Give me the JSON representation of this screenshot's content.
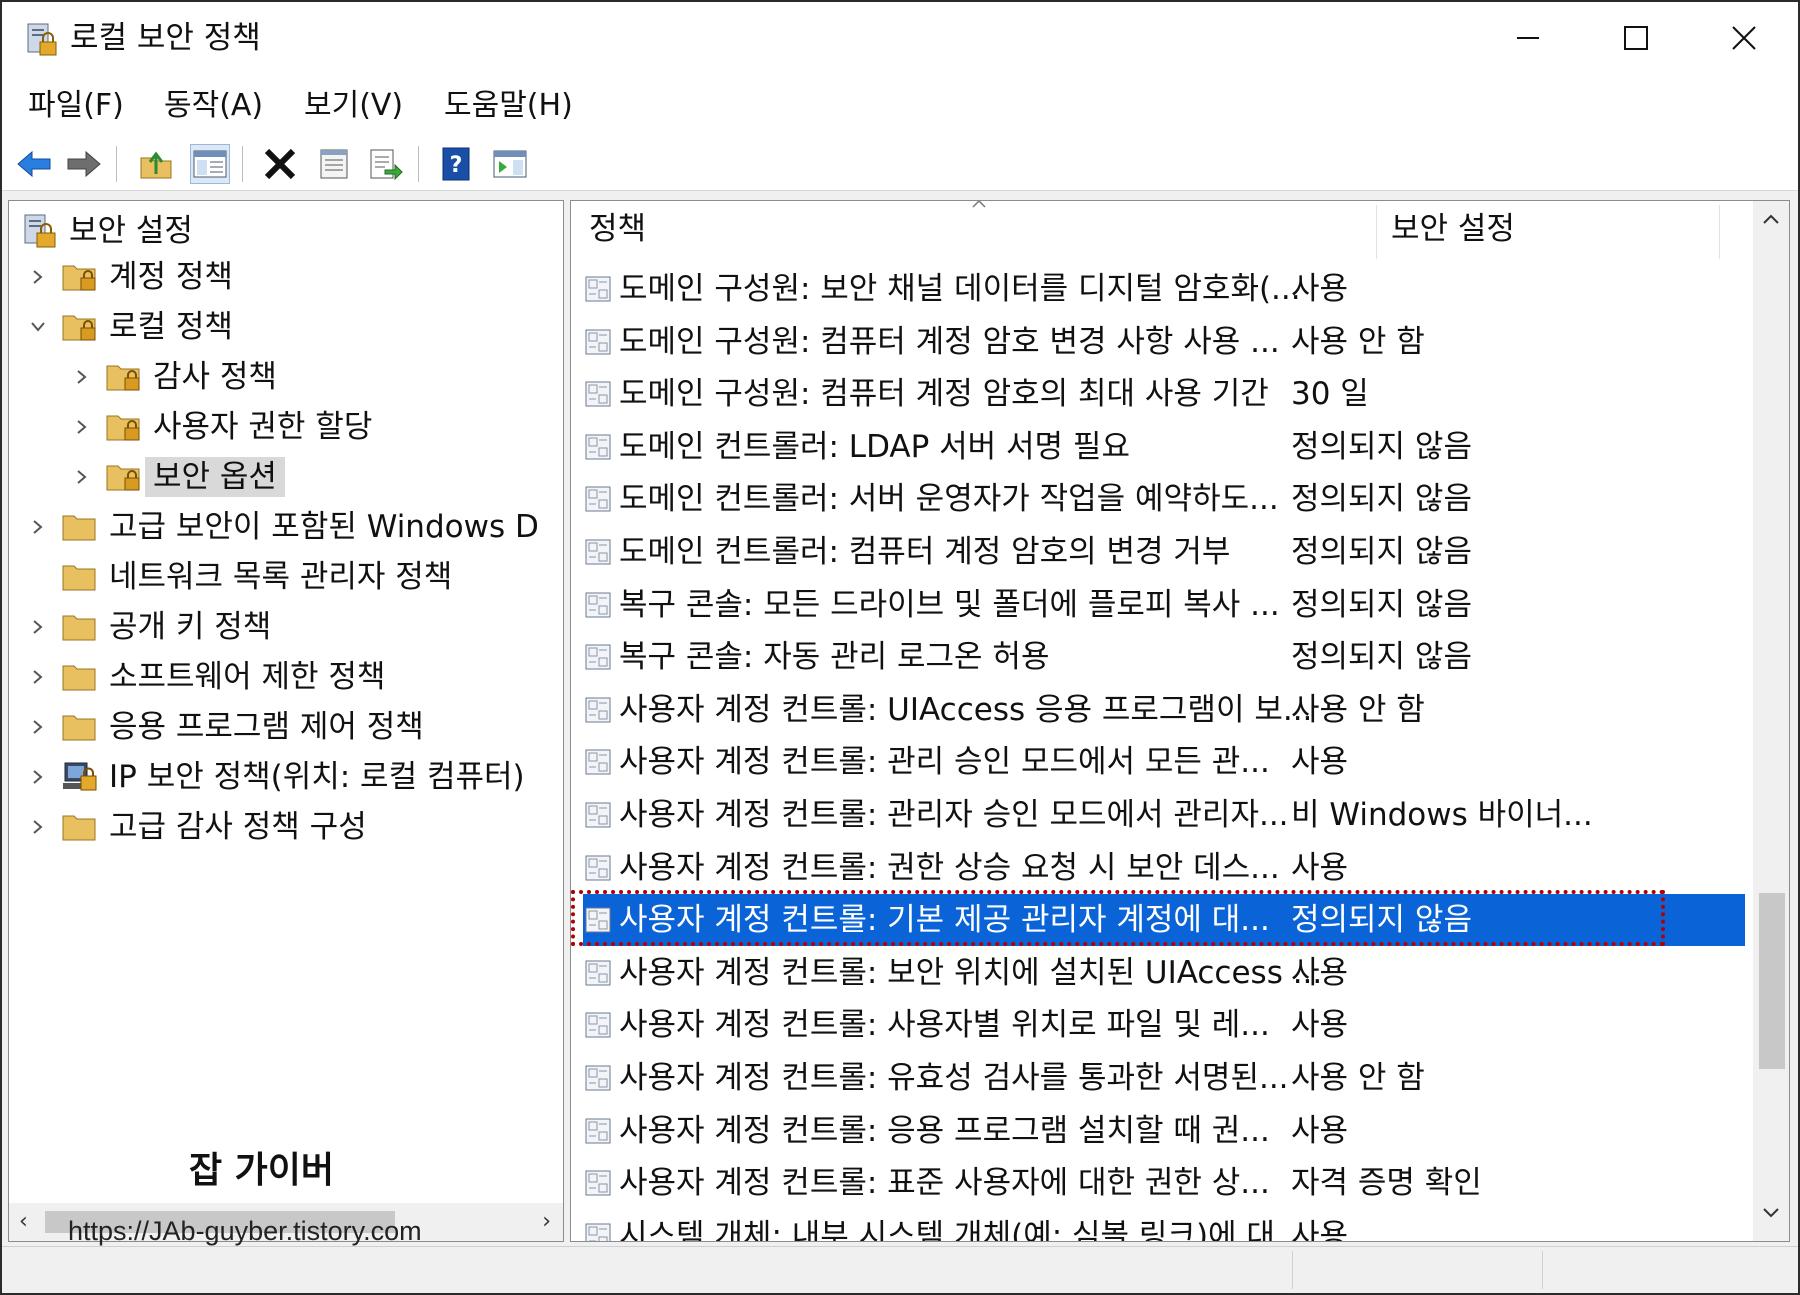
{
  "window": {
    "title": "로컬 보안 정책"
  },
  "menu": {
    "items": [
      "파일(F)",
      "동작(A)",
      "보기(V)",
      "도움말(H)"
    ]
  },
  "toolbar": {
    "buttons": [
      "back-icon",
      "forward-icon",
      "up-folder-icon",
      "show-hide-tree-icon",
      "delete-icon",
      "properties-icon",
      "export-list-icon",
      "help-icon",
      "action-pane-icon"
    ]
  },
  "tree": {
    "root": "보안 설정",
    "account_policy": "계정 정책",
    "local_policy": "로컬 정책",
    "audit_policy": "감사 정책",
    "user_rights": "사용자 권한 할당",
    "security_options": "보안 옵션",
    "windows_defender": "고급 보안이 포함된 Windows D",
    "network_list": "네트워크 목록 관리자 정책",
    "public_key": "공개 키 정책",
    "software_restriction": "소프트웨어 제한 정책",
    "app_control": "응용 프로그램 제어 정책",
    "ipsec": "IP 보안 정책(위치: 로컬 컴퓨터)",
    "advanced_audit": "고급 감사 정책 구성"
  },
  "watermark": {
    "name": "잡 가이버",
    "url": "https://JAb-guyber.tistory.com"
  },
  "list": {
    "columns": {
      "policy": "정책",
      "setting": "보안 설정"
    },
    "rows": [
      {
        "policy": "도메인 구성원: 보안 채널 데이터를 디지털 암호화(...",
        "setting": "사용"
      },
      {
        "policy": "도메인 구성원: 컴퓨터 계정 암호 변경 사항 사용 ...",
        "setting": "사용 안 함"
      },
      {
        "policy": "도메인 구성원: 컴퓨터 계정 암호의 최대 사용 기간",
        "setting": "30 일"
      },
      {
        "policy": "도메인 컨트롤러: LDAP 서버 서명 필요",
        "setting": "정의되지 않음"
      },
      {
        "policy": "도메인 컨트롤러: 서버 운영자가 작업을 예약하도...",
        "setting": "정의되지 않음"
      },
      {
        "policy": "도메인 컨트롤러: 컴퓨터 계정 암호의 변경 거부",
        "setting": "정의되지 않음"
      },
      {
        "policy": "복구 콘솔: 모든 드라이브 및 폴더에 플로피 복사 ...",
        "setting": "정의되지 않음"
      },
      {
        "policy": "복구 콘솔: 자동 관리 로그온 허용",
        "setting": "정의되지 않음"
      },
      {
        "policy": "사용자 계정 컨트롤: UIAccess 응용 프로그램이 보...",
        "setting": "사용 안 함"
      },
      {
        "policy": "사용자 계정 컨트롤: 관리 승인 모드에서 모든 관...",
        "setting": "사용"
      },
      {
        "policy": "사용자 계정 컨트롤: 관리자 승인 모드에서 관리자...",
        "setting": "비 Windows 바이너..."
      },
      {
        "policy": "사용자 계정 컨트롤: 권한 상승 요청 시 보안 데스...",
        "setting": "사용"
      },
      {
        "policy": "사용자 계정 컨트롤: 기본 제공 관리자 계정에 대...",
        "setting": "정의되지 않음"
      },
      {
        "policy": "사용자 계정 컨트롤: 보안 위치에 설치된 UIAccess ...",
        "setting": "사용"
      },
      {
        "policy": "사용자 계정 컨트롤: 사용자별 위치로 파일 및 레...",
        "setting": "사용"
      },
      {
        "policy": "사용자 계정 컨트롤: 유효성 검사를 통과한 서명된...",
        "setting": "사용 안 함"
      },
      {
        "policy": "사용자 계정 컨트롤: 응용 프로그램 설치할 때 권...",
        "setting": "사용"
      },
      {
        "policy": "사용자 계정 컨트롤: 표준 사용자에 대한 권한 상...",
        "setting": "자격 증명 확인"
      },
      {
        "policy": "시스템 개체: 내부 시스템 개체(예: 심볼 링크)에 대",
        "setting": "사용"
      }
    ],
    "selected_index": 12
  },
  "colors": {
    "selection": "#0a64d8",
    "highlight_box": "#b00000",
    "folder": "#e8c060"
  }
}
